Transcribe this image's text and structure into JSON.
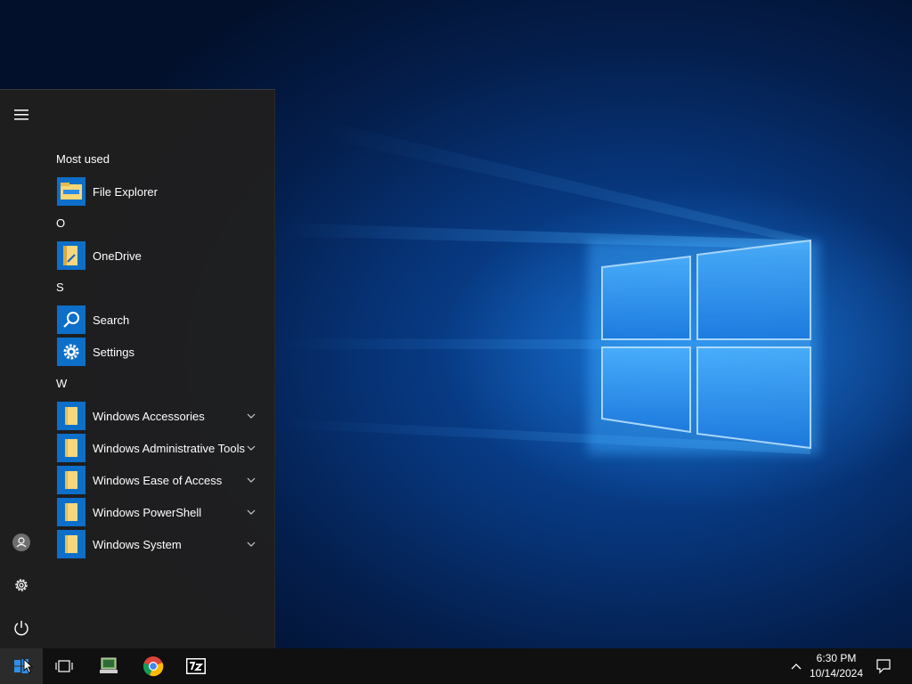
{
  "start_menu": {
    "sections": [
      {
        "header": "Most used",
        "items": [
          {
            "label": "File Explorer",
            "icon": "file-explorer-icon"
          }
        ]
      },
      {
        "header": "O",
        "items": [
          {
            "label": "OneDrive",
            "icon": "onedrive-icon"
          }
        ]
      },
      {
        "header": "S",
        "items": [
          {
            "label": "Search",
            "icon": "search-icon"
          },
          {
            "label": "Settings",
            "icon": "settings-gear-icon"
          }
        ]
      },
      {
        "header": "W",
        "items": [
          {
            "label": "Windows Accessories",
            "icon": "folder-icon",
            "expandable": true
          },
          {
            "label": "Windows Administrative Tools",
            "icon": "folder-icon",
            "expandable": true
          },
          {
            "label": "Windows Ease of Access",
            "icon": "folder-icon",
            "expandable": true
          },
          {
            "label": "Windows PowerShell",
            "icon": "folder-icon",
            "expandable": true
          },
          {
            "label": "Windows System",
            "icon": "folder-icon",
            "expandable": true
          }
        ]
      }
    ],
    "rail": [
      "hamburger-menu-icon",
      "user-account-icon",
      "settings-gear-icon",
      "power-icon"
    ]
  },
  "taskbar": {
    "clock": {
      "time": "6:30 PM",
      "date": "10/14/2024"
    },
    "pinned": [
      "start-windows-icon",
      "task-view-icon",
      "this-pc-icon",
      "chrome-icon",
      "7zip-icon"
    ],
    "tray": [
      "show-hidden-icons-chevron-icon",
      "action-center-notification-icon"
    ]
  },
  "colors": {
    "accent": "#0e6fc8",
    "menu_bg": "#1f1f1f",
    "taskbar_bg": "#101010",
    "folder_yellow": "#f6d77e"
  }
}
